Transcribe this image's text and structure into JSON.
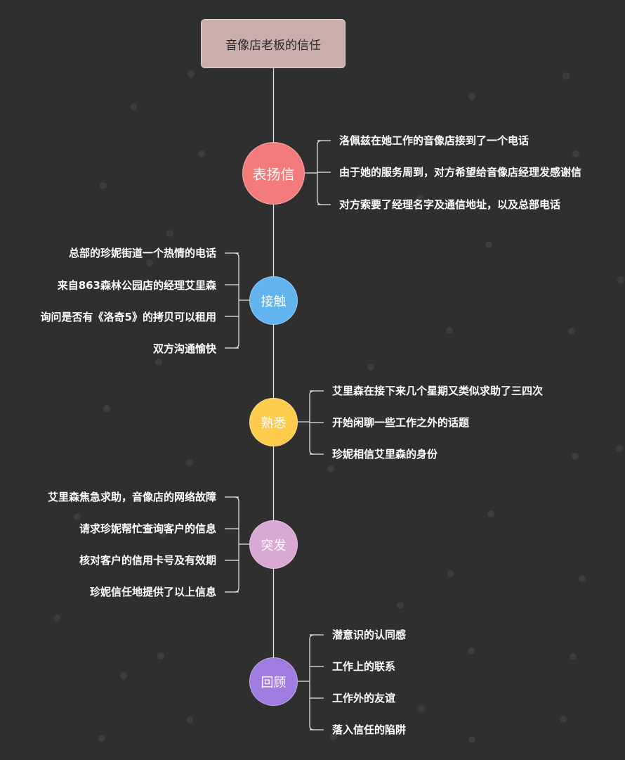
{
  "root": {
    "title": "音像店老板的信任"
  },
  "branches": [
    {
      "label": "表扬信",
      "color": "#f47b7b",
      "items": [
        "洛佩兹在她工作的音像店接到了一个电话",
        "由于她的服务周到，对方希望给音像店经理发感谢信",
        "对方索要了经理名字及通信地址，以及总部电话"
      ]
    },
    {
      "label": "接触",
      "color": "#62b4ee",
      "items": [
        "总部的珍妮街道一个热情的电话",
        "来自863森林公园店的经理艾里森",
        "询问是否有《洛奇5》的拷贝可以租用",
        "双方沟通愉快"
      ]
    },
    {
      "label": "熟悉",
      "color": "#fecb4d",
      "items": [
        "艾里森在接下来几个星期又类似求助了三四次",
        "开始闲聊一些工作之外的话题",
        "珍妮相信艾里森的身份"
      ]
    },
    {
      "label": "突发",
      "color": "#d9a8d3",
      "items": [
        "艾里森焦急求助，音像店的网络故障",
        "请求珍妮帮忙查询客户的信息",
        "核对客户的信用卡号及有效期",
        "珍妮信任地提供了以上信息"
      ]
    },
    {
      "label": "回顾",
      "color": "#9f7ce0",
      "items": [
        "潜意识的认同感",
        "工作上的联系",
        "工作外的友谊",
        "落入信任的陷阱"
      ]
    }
  ]
}
